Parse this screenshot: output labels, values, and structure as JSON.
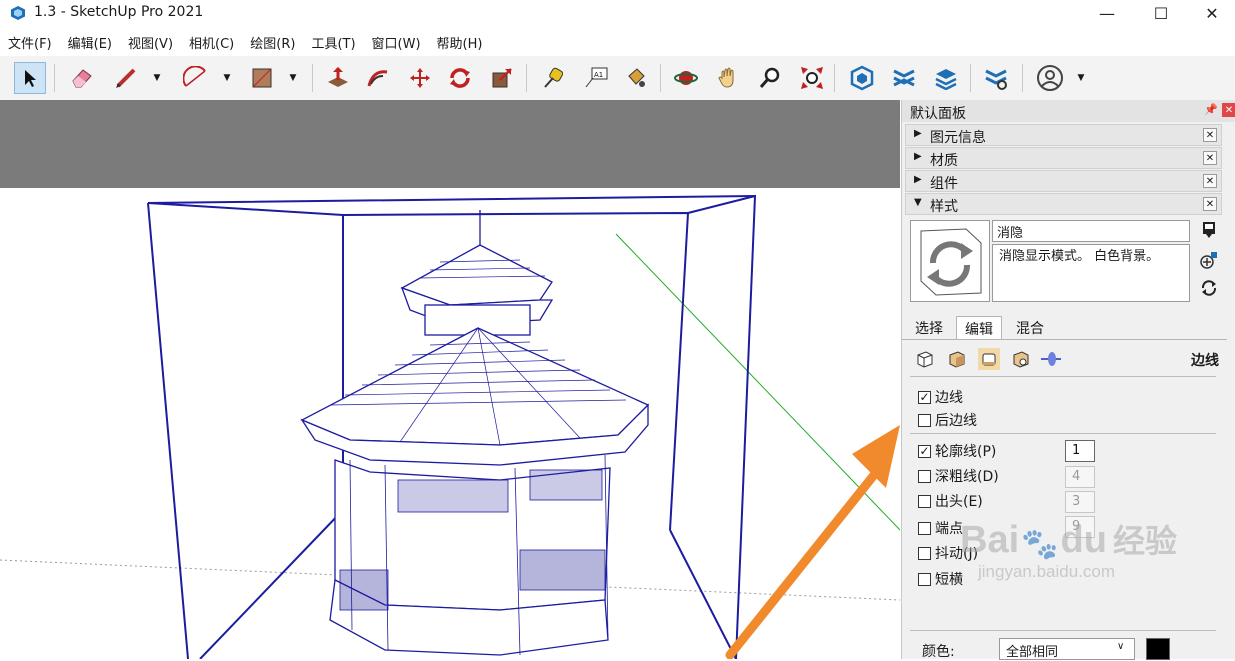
{
  "window": {
    "title": "1.3 - SketchUp Pro 2021",
    "minimize": "—",
    "maximize": "☐",
    "close": "✕"
  },
  "menu": [
    "文件(F)",
    "编辑(E)",
    "视图(V)",
    "相机(C)",
    "绘图(R)",
    "工具(T)",
    "窗口(W)",
    "帮助(H)"
  ],
  "tray": {
    "title": "默认面板",
    "panels": [
      {
        "label": "图元信息",
        "expanded": false
      },
      {
        "label": "材质",
        "expanded": false
      },
      {
        "label": "组件",
        "expanded": false
      },
      {
        "label": "样式",
        "expanded": true
      }
    ],
    "style": {
      "name": "消隐",
      "description": "消隐显示模式。 白色背景。",
      "tabs": [
        "选择",
        "编辑",
        "混合"
      ],
      "active_tab": "编辑",
      "section_label": "边线",
      "options": [
        {
          "label": "边线",
          "checked": true
        },
        {
          "label": "后边线",
          "checked": false
        },
        {
          "label": "轮廓线(P)",
          "checked": true,
          "value": "1",
          "enabled": true
        },
        {
          "label": "深粗线(D)",
          "checked": false,
          "value": "4",
          "enabled": false
        },
        {
          "label": "出头(E)",
          "checked": false,
          "value": "3",
          "enabled": false
        },
        {
          "label": "端点",
          "checked": false,
          "value": "9",
          "enabled": false
        },
        {
          "label": "抖动(J)",
          "checked": false
        },
        {
          "label": "短横",
          "checked": false
        }
      ],
      "color_label": "颜色:",
      "color_value": "全部相同",
      "color_swatch": "#000000"
    }
  },
  "watermark": {
    "brand": "Bai",
    "brand_suffix": "du",
    "product": "经验",
    "url": "jingyan.baidu.com"
  },
  "colors": {
    "model_lines": "#1c1ca0",
    "axis_green": "#22aa22",
    "arrow": "#f08a2c",
    "sky": "#7b7b7b"
  }
}
